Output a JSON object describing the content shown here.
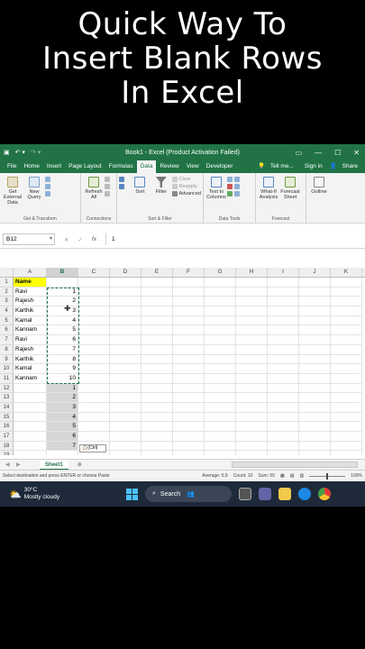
{
  "headline": [
    "Quick Way To",
    "Insert Blank Rows",
    "In Excel"
  ],
  "window": {
    "title": "Book1 - Excel (Product Activation Failed)",
    "controls": [
      "—",
      "☐",
      "✕"
    ]
  },
  "menu": {
    "tabs": [
      "File",
      "Home",
      "Insert",
      "Page Layout",
      "Formulas",
      "Data",
      "Review",
      "View",
      "Developer"
    ],
    "active": "Data",
    "tell_me": "Tell me...",
    "sign_in": "Sign in",
    "share": "Share"
  },
  "ribbon": {
    "get_external": "Get External Data",
    "new_query": "New Query",
    "group1": "Get & Transform",
    "refresh_all": "Refresh All",
    "group2": "Connections",
    "sort": "Sort",
    "filter": "Filter",
    "clear": "Clear",
    "reapply": "Reapply",
    "advanced": "Advanced",
    "group3": "Sort & Filter",
    "text_to_columns": "Text to Columns",
    "group4": "Data Tools",
    "what_if": "What-If Analysis",
    "forecast_sheet": "Forecast Sheet",
    "group5": "Forecast",
    "outline": "Outline"
  },
  "formula_bar": {
    "name_box": "B12",
    "cancel": "✕",
    "enter": "✓",
    "fx": "fx",
    "value": "1"
  },
  "columns": [
    "A",
    "B",
    "C",
    "D",
    "E",
    "F",
    "G",
    "H",
    "I",
    "J",
    "K"
  ],
  "rows": [
    {
      "n": "1",
      "a": "Name",
      "b": ""
    },
    {
      "n": "2",
      "a": "Ravi",
      "b": "1"
    },
    {
      "n": "3",
      "a": "Rajesh",
      "b": "2"
    },
    {
      "n": "4",
      "a": "Karthik",
      "b": "3"
    },
    {
      "n": "5",
      "a": "Kamal",
      "b": "4"
    },
    {
      "n": "6",
      "a": "Kannam",
      "b": "5"
    },
    {
      "n": "7",
      "a": "Ravi",
      "b": "6"
    },
    {
      "n": "8",
      "a": "Rajesh",
      "b": "7"
    },
    {
      "n": "9",
      "a": "Karthik",
      "b": "8"
    },
    {
      "n": "10",
      "a": "Kamal",
      "b": "9"
    },
    {
      "n": "11",
      "a": "Kannam",
      "b": "10"
    },
    {
      "n": "12",
      "a": "",
      "b": "1"
    },
    {
      "n": "13",
      "a": "",
      "b": "2"
    },
    {
      "n": "14",
      "a": "",
      "b": "3"
    },
    {
      "n": "15",
      "a": "",
      "b": "4"
    },
    {
      "n": "16",
      "a": "",
      "b": "5"
    },
    {
      "n": "17",
      "a": "",
      "b": "6"
    },
    {
      "n": "18",
      "a": "",
      "b": "7"
    },
    {
      "n": "19",
      "a": "",
      "b": ""
    }
  ],
  "paste_options": "(Ctrl)",
  "sheet_tab": "Sheet1",
  "status": {
    "message": "Select destination and press ENTER or choose Paste",
    "average": "Average: 5.5",
    "count": "Count: 10",
    "sum": "Sum: 55",
    "zoom": "100%"
  },
  "taskbar": {
    "temp": "30°C",
    "weather": "Mostly cloudy",
    "search": "Search"
  }
}
